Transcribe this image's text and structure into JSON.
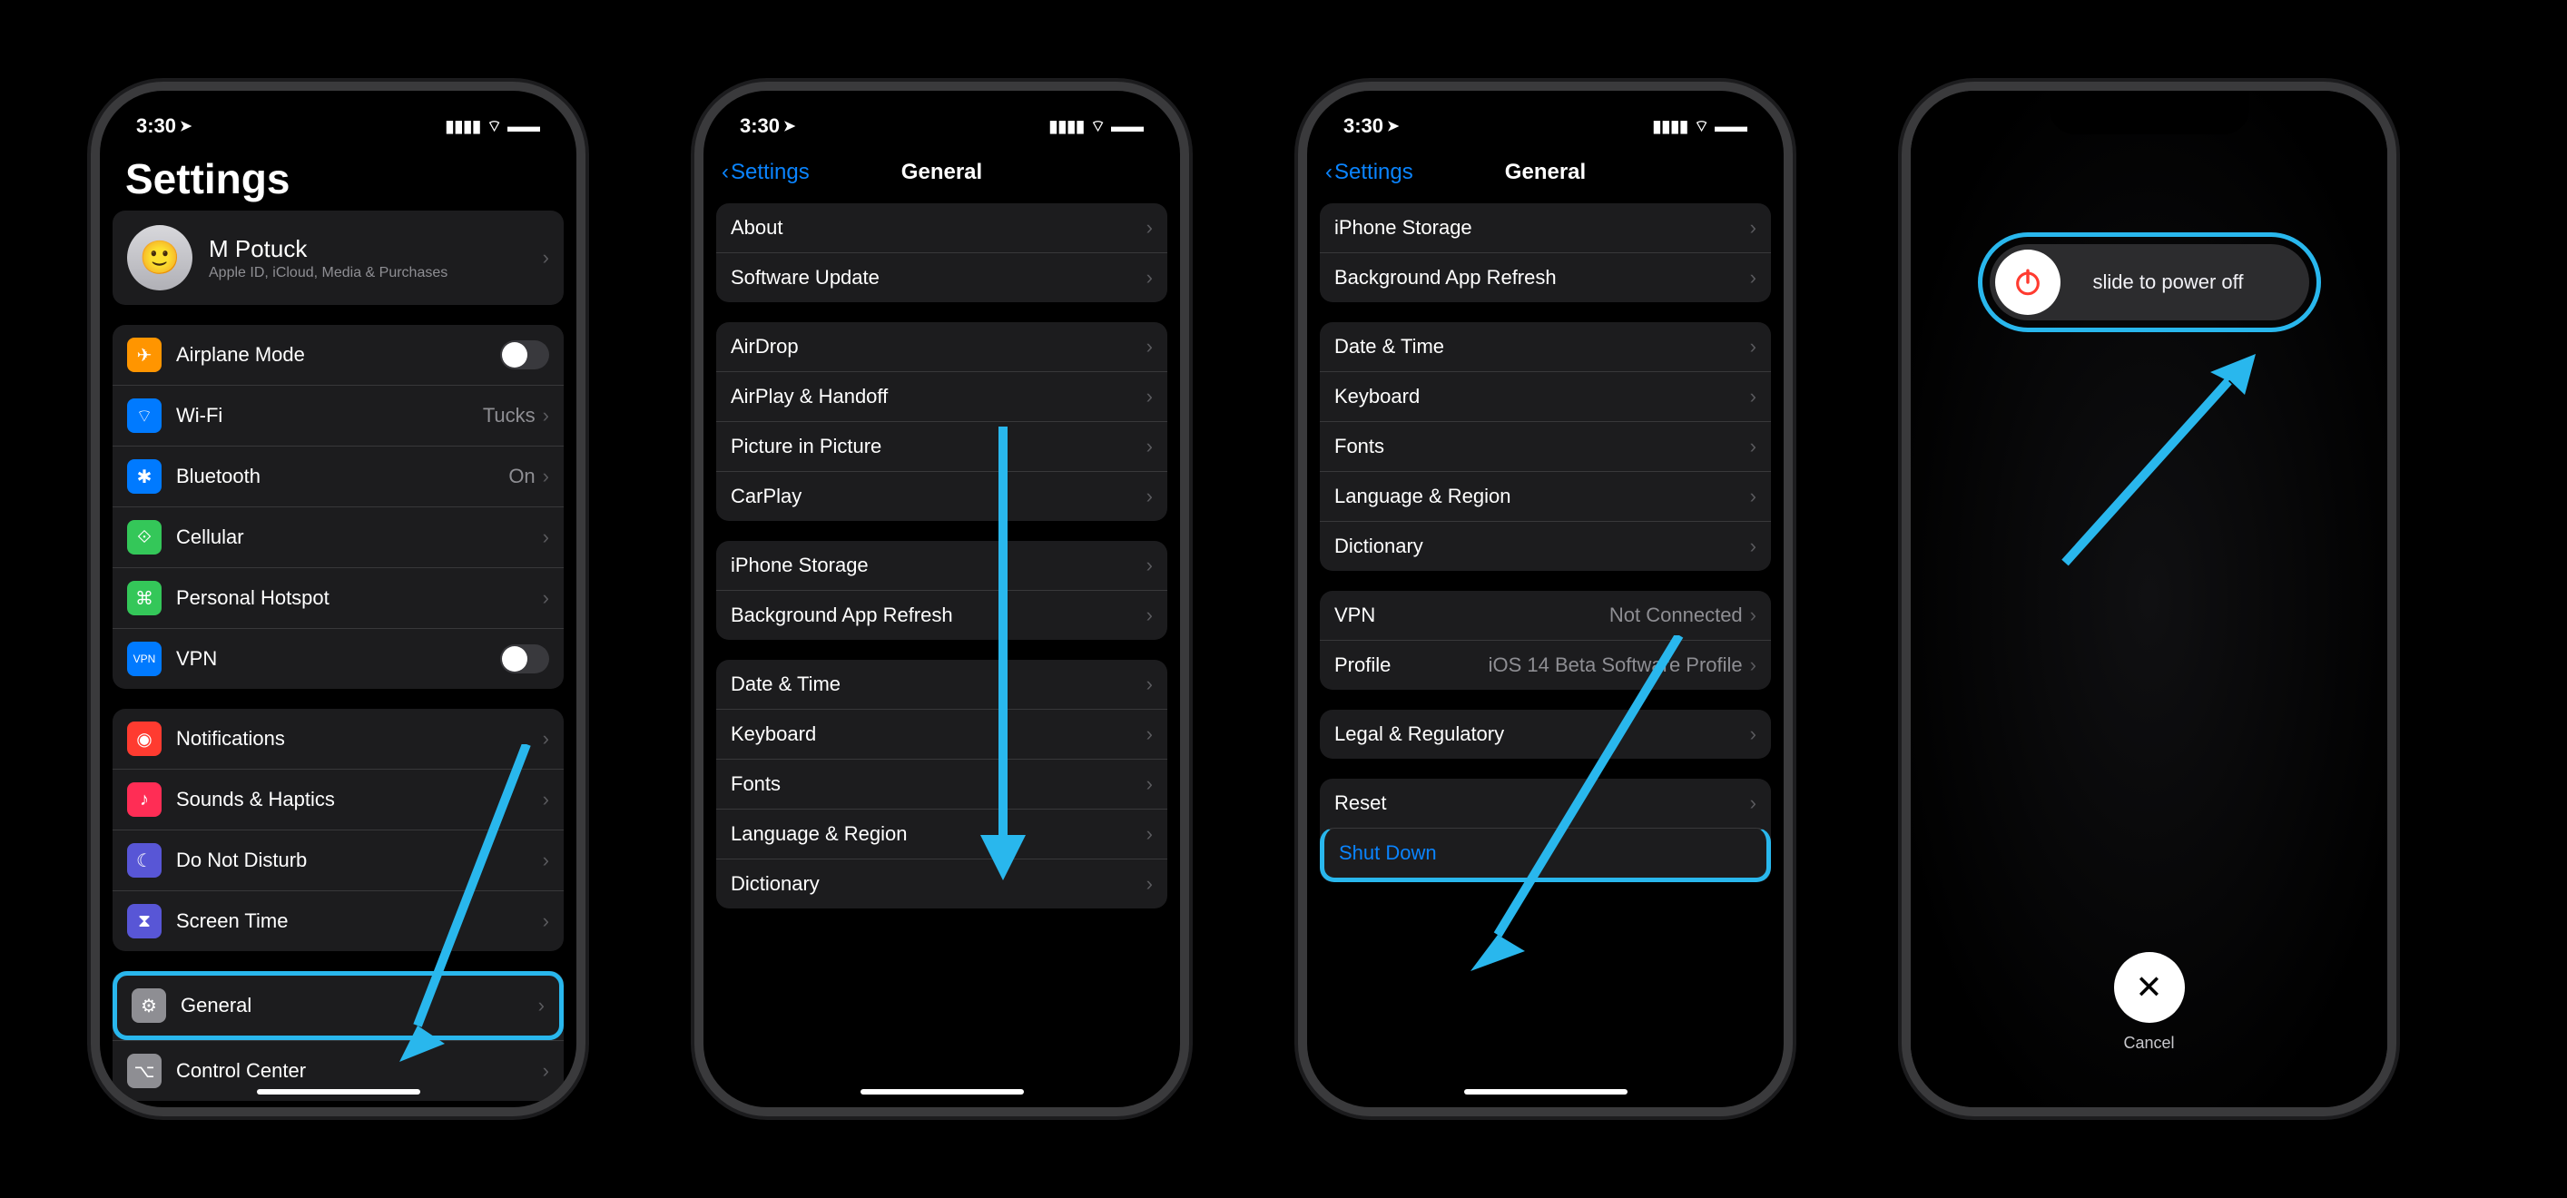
{
  "status": {
    "time": "3:30",
    "location_glyph": "➤",
    "signal": "▮▮▮▮",
    "wifi": "✓",
    "battery": "■"
  },
  "phone1": {
    "title": "Settings",
    "profile": {
      "name": "M Potuck",
      "sub": "Apple ID, iCloud, Media & Purchases"
    },
    "group1": [
      {
        "label": "Airplane Mode",
        "color": "#ff9500",
        "glyph": "✈",
        "type": "toggle"
      },
      {
        "label": "Wi-Fi",
        "color": "#007aff",
        "glyph": "⌔",
        "detail": "Tucks",
        "type": "chev"
      },
      {
        "label": "Bluetooth",
        "color": "#007aff",
        "glyph": "✱",
        "detail": "On",
        "type": "chev"
      },
      {
        "label": "Cellular",
        "color": "#34c759",
        "glyph": "⟐",
        "type": "chev"
      },
      {
        "label": "Personal Hotspot",
        "color": "#34c759",
        "glyph": "⌘",
        "type": "chev"
      },
      {
        "label": "VPN",
        "color": "#007aff",
        "glyph": "VPN",
        "type": "toggle"
      }
    ],
    "group2": [
      {
        "label": "Notifications",
        "color": "#ff3b30",
        "glyph": "◉"
      },
      {
        "label": "Sounds & Haptics",
        "color": "#ff2d55",
        "glyph": "♪"
      },
      {
        "label": "Do Not Disturb",
        "color": "#5856d6",
        "glyph": "☾"
      },
      {
        "label": "Screen Time",
        "color": "#5856d6",
        "glyph": "⧗"
      }
    ],
    "group3": [
      {
        "label": "General",
        "color": "#8e8e93",
        "glyph": "⚙",
        "highlight": true
      },
      {
        "label": "Control Center",
        "color": "#8e8e93",
        "glyph": "⌥"
      }
    ]
  },
  "phone2": {
    "back": "Settings",
    "title": "General",
    "group1": [
      {
        "label": "About"
      },
      {
        "label": "Software Update"
      }
    ],
    "group2": [
      {
        "label": "AirDrop"
      },
      {
        "label": "AirPlay & Handoff"
      },
      {
        "label": "Picture in Picture"
      },
      {
        "label": "CarPlay"
      }
    ],
    "group3": [
      {
        "label": "iPhone Storage"
      },
      {
        "label": "Background App Refresh"
      }
    ],
    "group4": [
      {
        "label": "Date & Time"
      },
      {
        "label": "Keyboard"
      },
      {
        "label": "Fonts"
      },
      {
        "label": "Language & Region"
      },
      {
        "label": "Dictionary"
      }
    ]
  },
  "phone3": {
    "back": "Settings",
    "title": "General",
    "group1": [
      {
        "label": "iPhone Storage"
      },
      {
        "label": "Background App Refresh"
      }
    ],
    "group2": [
      {
        "label": "Date & Time"
      },
      {
        "label": "Keyboard"
      },
      {
        "label": "Fonts"
      },
      {
        "label": "Language & Region"
      },
      {
        "label": "Dictionary"
      }
    ],
    "group3": [
      {
        "label": "VPN",
        "detail": "Not Connected"
      },
      {
        "label": "Profile",
        "detail": "iOS 14 Beta Software Profile"
      }
    ],
    "group4": [
      {
        "label": "Legal & Regulatory"
      }
    ],
    "group5": [
      {
        "label": "Reset"
      },
      {
        "label": "Shut Down",
        "blue": true,
        "highlight": true
      }
    ]
  },
  "phone4": {
    "slider_text": "slide to power off",
    "cancel": "Cancel"
  }
}
